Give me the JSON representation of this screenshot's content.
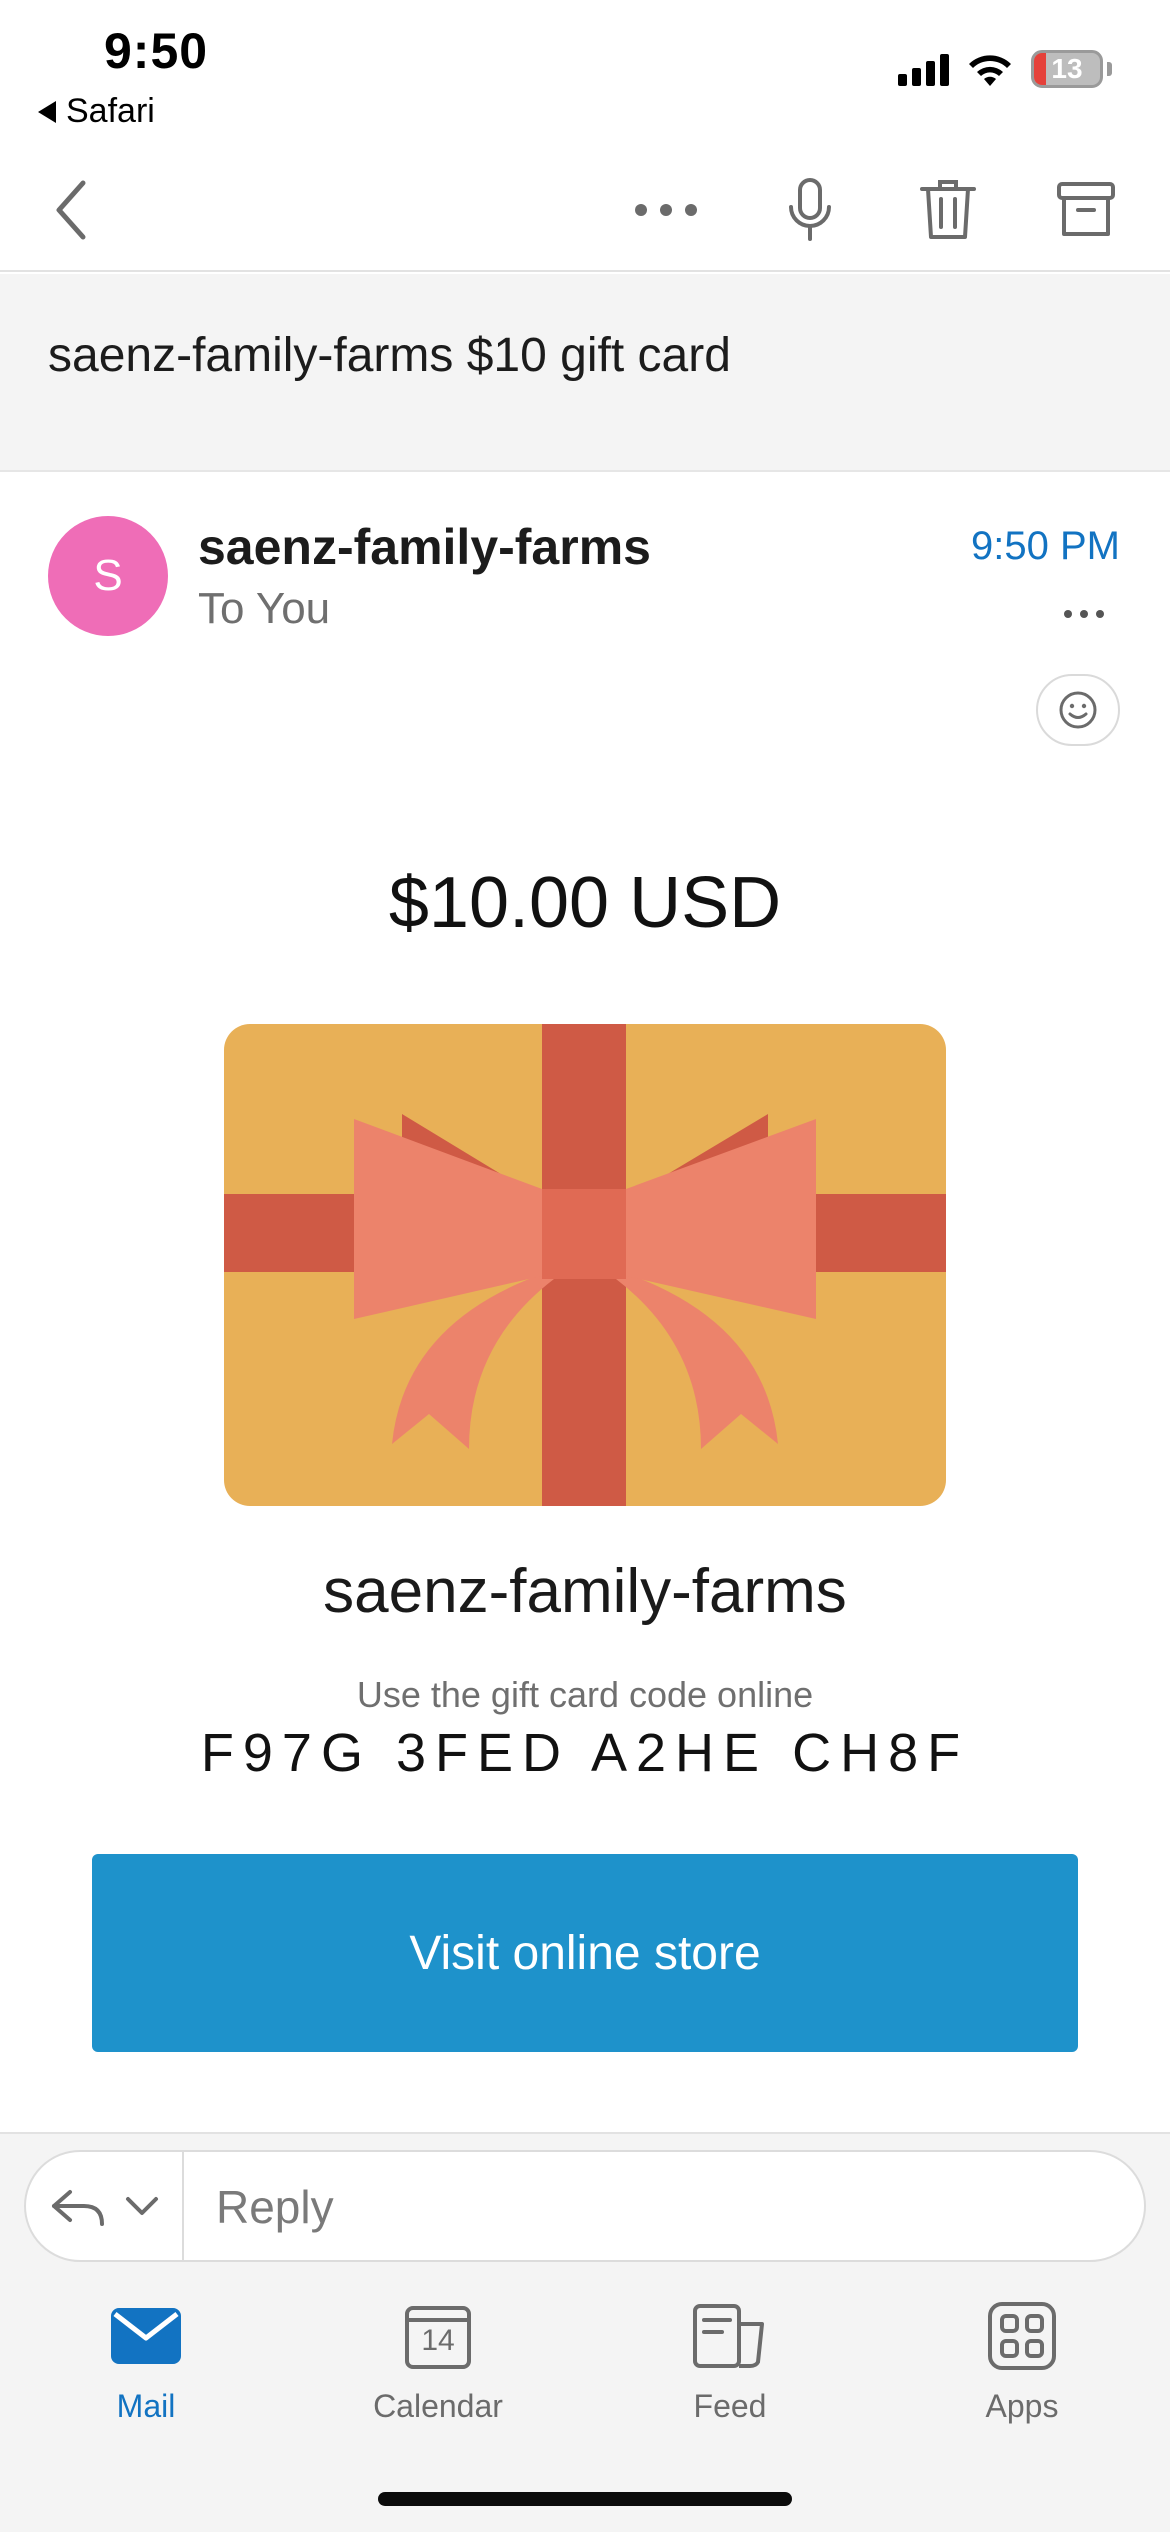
{
  "status_bar": {
    "time": "9:50",
    "back_app": "Safari",
    "battery_level": "13"
  },
  "toolbar": {
    "icons": [
      "back-chevron-icon",
      "more-dots-icon",
      "microphone-icon",
      "trash-icon",
      "archive-icon"
    ]
  },
  "email": {
    "subject": "saenz-family-farms $10 gift card",
    "sender_initial": "S",
    "sender": "saenz-family-farms",
    "recipient": "To You",
    "time": "9:50 PM",
    "avatar_color": "#ef6db7"
  },
  "gift_card": {
    "amount": "$10.00 USD",
    "brand": "saenz-family-farms",
    "hint": "Use the gift card code online",
    "code": "F97G 3FED A2HE CH8F",
    "button_label": "Visit online store",
    "button_color": "#1e92cb",
    "card_color": "#e8b057",
    "ribbon_color": "#cf5a45",
    "bow_color": "#ec836b"
  },
  "reply": {
    "placeholder": "Reply"
  },
  "tabs": [
    {
      "label": "Mail",
      "icon": "mail-icon",
      "active": true
    },
    {
      "label": "Calendar",
      "icon": "calendar-icon",
      "calendar_day": "14",
      "active": false
    },
    {
      "label": "Feed",
      "icon": "feed-icon",
      "active": false
    },
    {
      "label": "Apps",
      "icon": "apps-grid-icon",
      "active": false
    }
  ],
  "colors": {
    "accent": "#1273c2"
  }
}
